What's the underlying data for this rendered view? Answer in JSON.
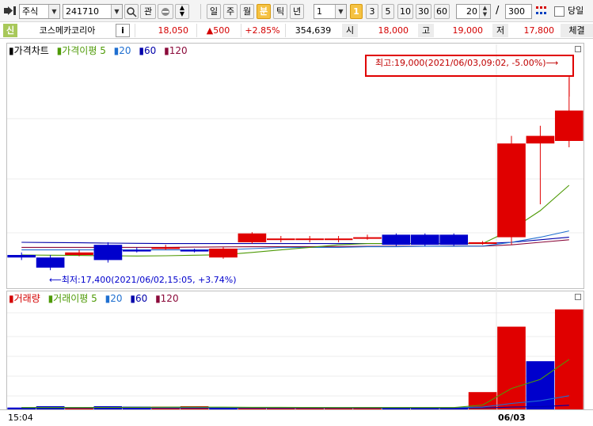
{
  "toolbar": {
    "market": "주식",
    "code": "241710",
    "btn_interest": "관",
    "periods": [
      "일",
      "주",
      "월",
      "분",
      "틱",
      "년"
    ],
    "interval_value": "1",
    "minute_options": [
      "1",
      "3",
      "5",
      "10",
      "30",
      "60"
    ],
    "count_value": "20",
    "count_sep": "/",
    "total_value": "300",
    "today_label": "당일"
  },
  "info": {
    "tag": "신",
    "stock_name": "코스메카코리아",
    "info_btn": "i",
    "price": "18,050",
    "change": "▲500",
    "change_pct": "+2.85%",
    "volume": "354,639",
    "open_label": "시",
    "open": "18,000",
    "high_label": "고",
    "high": "19,000",
    "low_label": "저",
    "low": "17,800",
    "trade_label": "체결"
  },
  "price_panel": {
    "legend": [
      {
        "text": "가격차트",
        "color": "#000000"
      },
      {
        "text": "가격이평 5",
        "color": "#4e9a06"
      },
      {
        "text": "20",
        "color": "#1f6fd0"
      },
      {
        "text": "60",
        "color": "#0000aa"
      },
      {
        "text": "120",
        "color": "#8b0a3a"
      }
    ],
    "annot_high": "최고:19,000(2021/06/03,09:02, -5.00%)⟶",
    "annot_low": "⟵최저:17,400(2021/06/02,15:05, +3.74%)"
  },
  "volume_panel": {
    "legend": [
      {
        "text": "거래량",
        "color": "#d40000"
      },
      {
        "text": "거래이평 5",
        "color": "#4e9a06"
      },
      {
        "text": "20",
        "color": "#1f6fd0"
      },
      {
        "text": "60",
        "color": "#0000aa"
      },
      {
        "text": "120",
        "color": "#8b0a3a"
      }
    ]
  },
  "xaxis": {
    "left_label": "15:04",
    "date_label": "06/03"
  },
  "colors": {
    "up": "#e00000",
    "down": "#0000cc",
    "ma5": "#4e9a06",
    "ma20": "#1f6fd0",
    "ma60": "#0000aa",
    "ma120": "#8b0a3a"
  },
  "chart_data": {
    "type": "candlestick",
    "x_labels": [
      "15:04",
      "06/03"
    ],
    "candles": [
      {
        "open": 17600,
        "close": 17580,
        "high": 17620,
        "low": 17560
      },
      {
        "open": 17580,
        "close": 17500,
        "high": 17600,
        "low": 17480
      },
      {
        "open": 17600,
        "close": 17620,
        "high": 17640,
        "low": 17590
      },
      {
        "open": 17680,
        "close": 17560,
        "high": 17700,
        "low": 17540
      },
      {
        "open": 17640,
        "close": 17630,
        "high": 17660,
        "low": 17620
      },
      {
        "open": 17650,
        "close": 17660,
        "high": 17680,
        "low": 17640
      },
      {
        "open": 17640,
        "close": 17630,
        "high": 17650,
        "low": 17620
      },
      {
        "open": 17580,
        "close": 17650,
        "high": 17660,
        "low": 17570
      },
      {
        "open": 17700,
        "close": 17770,
        "high": 17780,
        "low": 17690
      },
      {
        "open": 17720,
        "close": 17730,
        "high": 17750,
        "low": 17700
      },
      {
        "open": 17720,
        "close": 17730,
        "high": 17750,
        "low": 17700
      },
      {
        "open": 17720,
        "close": 17730,
        "high": 17750,
        "low": 17700
      },
      {
        "open": 17730,
        "close": 17740,
        "high": 17760,
        "low": 17720
      },
      {
        "open": 17760,
        "close": 17680,
        "high": 17770,
        "low": 17670
      },
      {
        "open": 17760,
        "close": 17680,
        "high": 17770,
        "low": 17670
      },
      {
        "open": 17760,
        "close": 17680,
        "high": 17770,
        "low": 17670
      },
      {
        "open": 17690,
        "close": 17700,
        "high": 17710,
        "low": 17680
      },
      {
        "open": 17740,
        "close": 18480,
        "high": 18540,
        "low": 17680
      },
      {
        "open": 18480,
        "close": 18540,
        "high": 18620,
        "low": 18000
      },
      {
        "open": 18500,
        "close": 18740,
        "high": 19000,
        "low": 18450
      }
    ],
    "ma5": [
      17600,
      17598,
      17596,
      17594,
      17592,
      17594,
      17598,
      17602,
      17620,
      17640,
      17660,
      17680,
      17690,
      17690,
      17690,
      17690,
      17690,
      17800,
      17950,
      18150
    ],
    "ma20": [
      17640,
      17640,
      17640,
      17640,
      17640,
      17640,
      17640,
      17640,
      17650,
      17660,
      17660,
      17660,
      17665,
      17665,
      17668,
      17668,
      17670,
      17700,
      17740,
      17790
    ],
    "ma60": [
      17700,
      17698,
      17696,
      17694,
      17692,
      17690,
      17690,
      17690,
      17690,
      17690,
      17690,
      17690,
      17690,
      17690,
      17690,
      17690,
      17690,
      17700,
      17720,
      17740
    ],
    "ma120": [
      17660,
      17660,
      17660,
      17660,
      17660,
      17660,
      17662,
      17664,
      17665,
      17665,
      17666,
      17667,
      17668,
      17668,
      17669,
      17670,
      17670,
      17680,
      17700,
      17720
    ],
    "ylim": [
      17350,
      19050
    ],
    "volume": [
      {
        "value": 2000,
        "dir": "down"
      },
      {
        "value": 3500,
        "dir": "down"
      },
      {
        "value": 2500,
        "dir": "up"
      },
      {
        "value": 3500,
        "dir": "down"
      },
      {
        "value": 3000,
        "dir": "down"
      },
      {
        "value": 3000,
        "dir": "up"
      },
      {
        "value": 3500,
        "dir": "up"
      },
      {
        "value": 2000,
        "dir": "down"
      },
      {
        "value": 2000,
        "dir": "up"
      },
      {
        "value": 2000,
        "dir": "up"
      },
      {
        "value": 2000,
        "dir": "up"
      },
      {
        "value": 2000,
        "dir": "up"
      },
      {
        "value": 2500,
        "dir": "up"
      },
      {
        "value": 2000,
        "dir": "down"
      },
      {
        "value": 2000,
        "dir": "down"
      },
      {
        "value": 2000,
        "dir": "down"
      },
      {
        "value": 19000,
        "dir": "up"
      },
      {
        "value": 91000,
        "dir": "up"
      },
      {
        "value": 53000,
        "dir": "down"
      },
      {
        "value": 110000,
        "dir": "up"
      }
    ],
    "vol_ma5": [
      2000,
      2000,
      2000,
      2200,
      2300,
      2400,
      2500,
      2400,
      2300,
      2300,
      2100,
      2000,
      2000,
      2000,
      2000,
      2000,
      4800,
      23000,
      33000,
      55000
    ],
    "vol_ma20": [
      2000,
      2000,
      2000,
      2000,
      2000,
      2000,
      2000,
      2000,
      2000,
      2000,
      2000,
      2000,
      2000,
      2000,
      2000,
      2000,
      2500,
      6500,
      9500,
      15000
    ],
    "vol_ma60": [
      1500,
      1500,
      1500,
      1500,
      1500,
      1500,
      1500,
      1500,
      1500,
      1500,
      1500,
      1500,
      1500,
      1500,
      1500,
      1500,
      1600,
      2500,
      3000,
      4500
    ],
    "vol_ylim": [
      0,
      115000
    ]
  }
}
